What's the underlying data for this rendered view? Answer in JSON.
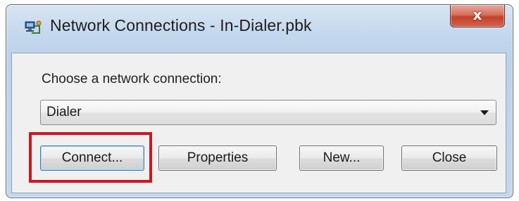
{
  "window": {
    "title": "Network Connections - In-Dialer.pbk",
    "icon": "network-connection-icon",
    "close_glyph": "x"
  },
  "dialog": {
    "prompt_label": "Choose a network connection:",
    "connection_select": {
      "selected_value": "Dialer"
    },
    "buttons": {
      "connect": "Connect...",
      "properties": "Properties",
      "new": "New...",
      "close": "Close"
    }
  },
  "annotation": {
    "highlight_color": "#d0151c",
    "highlighted_element": "connect-button"
  }
}
